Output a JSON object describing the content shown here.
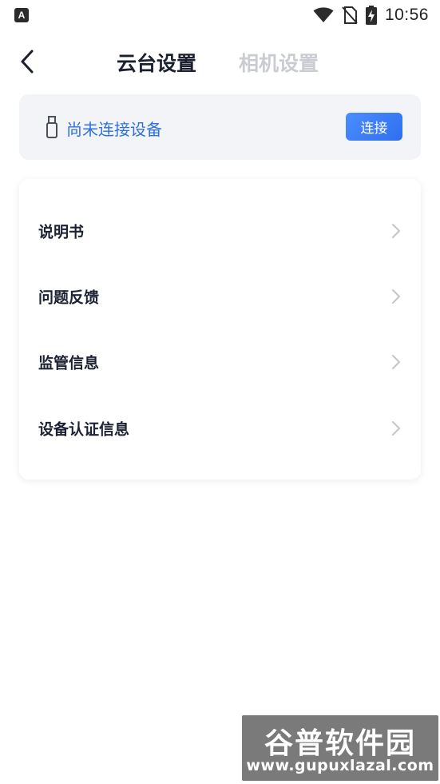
{
  "status_bar": {
    "left_icon": "a-notification-icon",
    "icons": [
      "wifi-icon",
      "no-sim-icon",
      "battery-charging-icon"
    ],
    "time": "10:56"
  },
  "header": {
    "back_icon": "chevron-left-icon",
    "tabs": [
      {
        "label": "云台设置",
        "active": true
      },
      {
        "label": "相机设置",
        "active": false
      }
    ]
  },
  "device": {
    "icon": "usb-stick-icon",
    "status": "尚未连接设备",
    "connect_label": "连接"
  },
  "menu": {
    "items": [
      {
        "label": "说明书"
      },
      {
        "label": "问题反馈"
      },
      {
        "label": "监管信息"
      },
      {
        "label": "设备认证信息"
      }
    ]
  },
  "watermark": {
    "title": "谷普软件园",
    "url": "www.gupuxlazal.com"
  },
  "colors": {
    "accent": "#2f6fe0",
    "button_gradient_start": "#4c8dff",
    "button_gradient_end": "#2e6ff0",
    "card_bg": "#f3f4f7",
    "inactive_tab": "#c9ccd2"
  }
}
